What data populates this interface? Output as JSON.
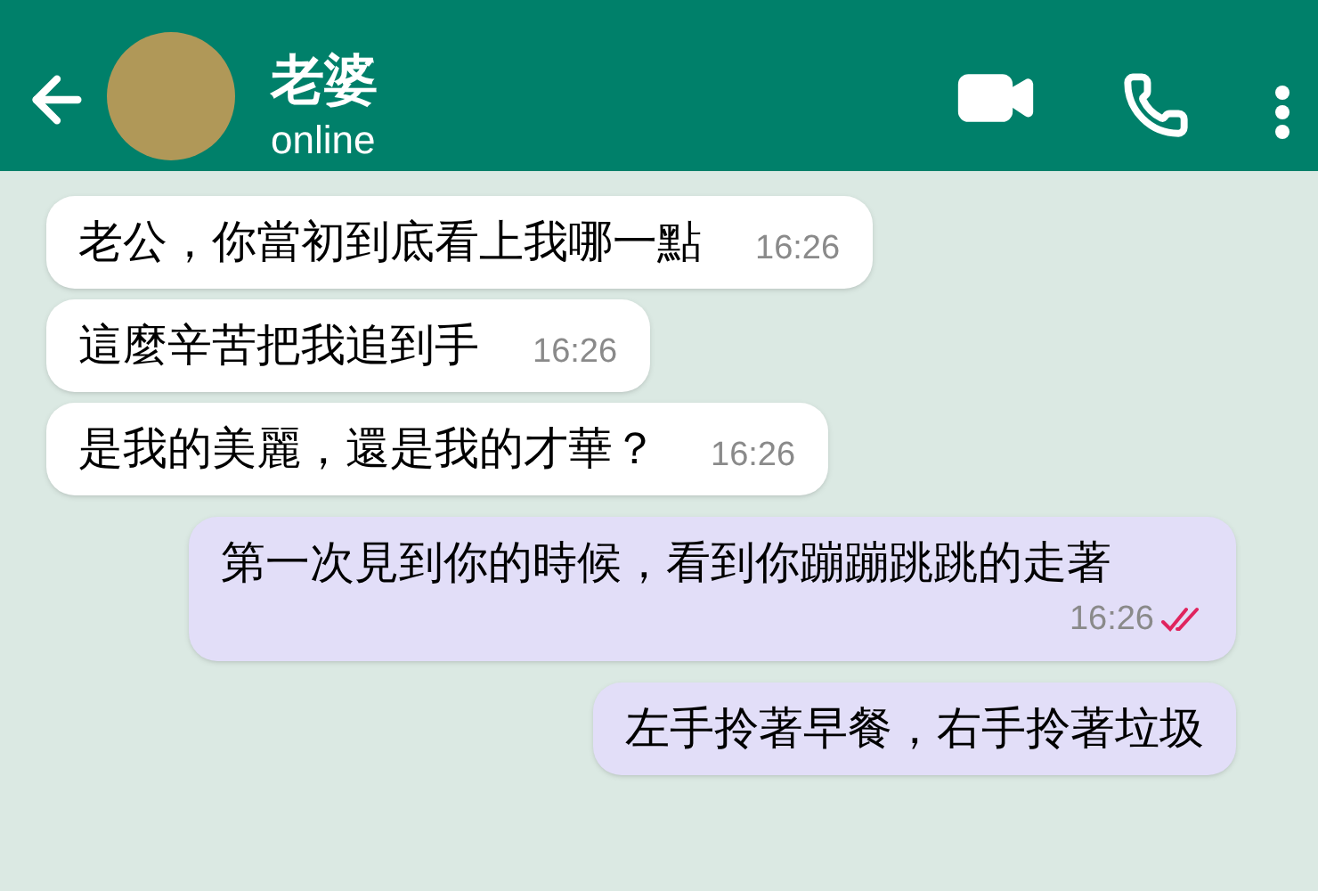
{
  "header": {
    "name": "老婆",
    "status": "online"
  },
  "messages": [
    {
      "kind": "received",
      "text": "老公，你當初到底看上我哪一點",
      "time": "16:26"
    },
    {
      "kind": "received",
      "text": "這麼辛苦把我追到手",
      "time": "16:26"
    },
    {
      "kind": "received",
      "text": "是我的美麗，還是我的才華？",
      "time": "16:26"
    },
    {
      "kind": "sent",
      "text": "第一次見到你的時候，看到你蹦蹦跳跳的走著",
      "time": "16:26",
      "read": true
    },
    {
      "kind": "sent",
      "text": "左手拎著早餐，右手拎著垃圾"
    }
  ]
}
